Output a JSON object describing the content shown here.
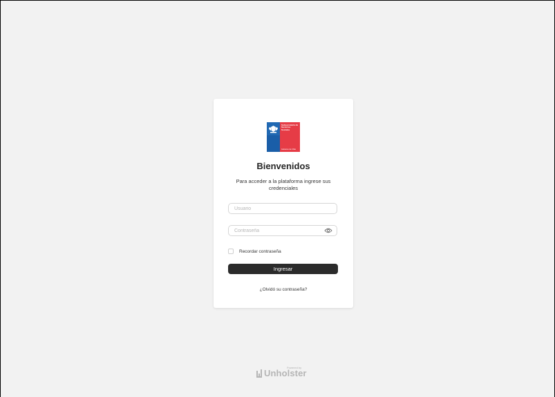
{
  "logo": {
    "org_name": "Subsecretaría de Servicios Sociales",
    "gov_text": "Gobierno de Chile",
    "colors": {
      "blue": "#1a5ea8",
      "red": "#e63c46"
    }
  },
  "login": {
    "title": "Bienvenidos",
    "subtitle": "Para acceder a la plataforma ingrese sus credenciales",
    "username_placeholder": "Usuario",
    "username_value": "",
    "password_placeholder": "Contraseña",
    "password_value": "",
    "password_toggle_icon": "eye-icon",
    "remember_label": "Recordar contraseña",
    "remember_checked": false,
    "submit_label": "Ingresar",
    "forgot_label": "¿Olvidó su contraseña?"
  },
  "footer": {
    "powered_by": "Powered by",
    "brand": "Unholster"
  },
  "colors": {
    "background": "#f2f2f2",
    "card": "#ffffff",
    "button": "#2b2b2b"
  }
}
